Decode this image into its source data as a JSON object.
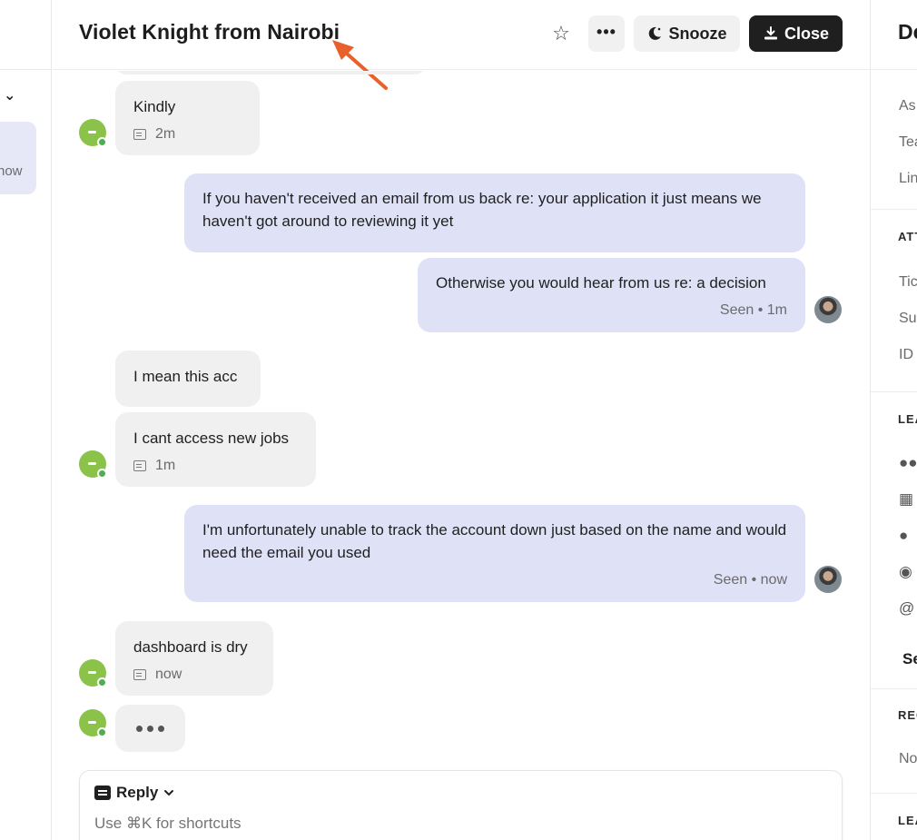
{
  "left_rail": {
    "chevron": "⌄",
    "conversation_time": "now"
  },
  "header": {
    "title": "Violet Knight from Nairobi",
    "more_label": "•••",
    "snooze_label": "Snooze",
    "close_label": "Close"
  },
  "messages": [
    {
      "text": "Kindly",
      "meta": "2m",
      "side": "in"
    },
    {
      "text": "If you haven't received an email from us back re: your application it just means we haven't got around to reviewing it yet",
      "side": "out"
    },
    {
      "text": "Otherwise you would hear from us re: a decision",
      "meta": "Seen • 1m",
      "side": "out"
    },
    {
      "text": "I mean this acc",
      "side": "in"
    },
    {
      "text": "I cant access new jobs",
      "meta": "1m",
      "side": "in"
    },
    {
      "text": "I'm unfortunately unable to track the account down just based on the name and would need the email you used",
      "meta": "Seen • now",
      "side": "out"
    },
    {
      "text": "dashboard is dry",
      "meta": "now",
      "side": "in"
    }
  ],
  "composer": {
    "mode_label": "Reply",
    "placeholder": "Use ⌘K for shortcuts"
  },
  "right_panel": {
    "title": "De",
    "rows": [
      "As",
      "Tea",
      "Lin"
    ],
    "section_attributes": "ATT",
    "attr_rows": [
      "Tic",
      "Su",
      "ID"
    ],
    "section_lead": "LEA",
    "see_label": "Se",
    "section_recent": "REC",
    "recent_text": "No",
    "section_lead2": "LEA"
  },
  "colors": {
    "annotation_arrow": "#e8612c",
    "user_avatar": "#8bc34a",
    "outgoing_bubble": "#dfe2f7",
    "incoming_bubble": "#f0f0f0",
    "close_button": "#1f1f1f"
  }
}
